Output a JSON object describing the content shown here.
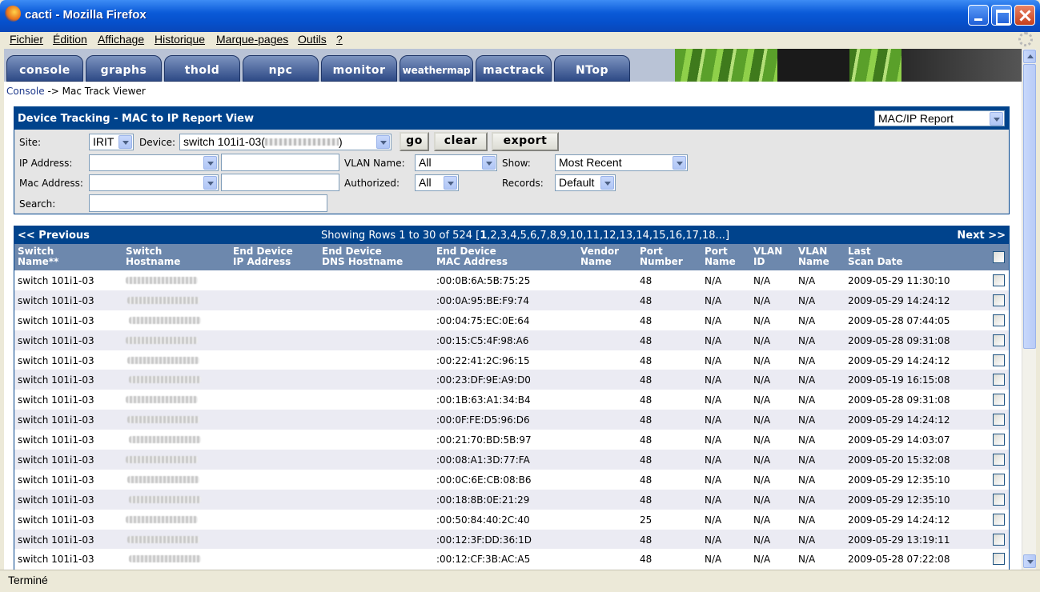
{
  "window": {
    "title": "cacti - Mozilla Firefox"
  },
  "menu": [
    "Fichier",
    "Édition",
    "Affichage",
    "Historique",
    "Marque-pages",
    "Outils",
    "?"
  ],
  "tabs": [
    "console",
    "graphs",
    "thold",
    "npc",
    "monitor",
    "weathermap",
    "mactrack",
    "NTop"
  ],
  "breadcrumb": {
    "link": "Console",
    "rest": " -> Mac Track Viewer"
  },
  "filter": {
    "title": "Device Tracking - MAC to IP Report View",
    "report_select": "MAC/IP Report",
    "site_label": "Site:",
    "site_value": "IRIT",
    "device_label": "Device:",
    "device_value": "switch 101i1-03(",
    "device_suffix": ")",
    "go": "go",
    "clear": "clear",
    "export": "export",
    "ip_label": "IP Address:",
    "vlan_label": "VLAN Name:",
    "vlan_value": "All",
    "show_label": "Show:",
    "show_value": "Most Recent",
    "mac_label": "Mac Address:",
    "authorized_label": "Authorized:",
    "authorized_value": "All",
    "records_label": "Records:",
    "records_value": "Default",
    "search_label": "Search:"
  },
  "results": {
    "prev": "<< Previous",
    "next": "Next >>",
    "showing_prefix": "Showing Rows 1 to 30 of 524 [",
    "showing_current": "1",
    "showing_pages": ",2,3,4,5,6,7,8,9,10,11,12,13,14,15,16,17,18...]",
    "headers": [
      [
        "Switch",
        "Name**"
      ],
      [
        "Switch",
        "Hostname"
      ],
      [
        "End Device",
        "IP Address"
      ],
      [
        "End Device",
        "DNS Hostname"
      ],
      [
        "End Device",
        "MAC Address"
      ],
      [
        "Vendor",
        "Name"
      ],
      [
        "Port",
        "Number"
      ],
      [
        "Port",
        "Name"
      ],
      [
        "VLAN",
        "ID"
      ],
      [
        "VLAN",
        "Name"
      ],
      [
        "Last",
        "Scan Date"
      ]
    ],
    "rows": [
      {
        "switch": "switch 101i1-03",
        "mac": ":00:0B:6A:5B:75:25",
        "port": "48",
        "port_name": "N/A",
        "vlan_id": "N/A",
        "vlan_name": "N/A",
        "date": "2009-05-29 11:30:10"
      },
      {
        "switch": "switch 101i1-03",
        "mac": ":00:0A:95:BE:F9:74",
        "port": "48",
        "port_name": "N/A",
        "vlan_id": "N/A",
        "vlan_name": "N/A",
        "date": "2009-05-29 14:24:12"
      },
      {
        "switch": "switch 101i1-03",
        "mac": ":00:04:75:EC:0E:64",
        "port": "48",
        "port_name": "N/A",
        "vlan_id": "N/A",
        "vlan_name": "N/A",
        "date": "2009-05-28 07:44:05"
      },
      {
        "switch": "switch 101i1-03",
        "mac": ":00:15:C5:4F:98:A6",
        "port": "48",
        "port_name": "N/A",
        "vlan_id": "N/A",
        "vlan_name": "N/A",
        "date": "2009-05-28 09:31:08"
      },
      {
        "switch": "switch 101i1-03",
        "mac": ":00:22:41:2C:96:15",
        "port": "48",
        "port_name": "N/A",
        "vlan_id": "N/A",
        "vlan_name": "N/A",
        "date": "2009-05-29 14:24:12"
      },
      {
        "switch": "switch 101i1-03",
        "mac": ":00:23:DF:9E:A9:D0",
        "port": "48",
        "port_name": "N/A",
        "vlan_id": "N/A",
        "vlan_name": "N/A",
        "date": "2009-05-19 16:15:08"
      },
      {
        "switch": "switch 101i1-03",
        "mac": ":00:1B:63:A1:34:B4",
        "port": "48",
        "port_name": "N/A",
        "vlan_id": "N/A",
        "vlan_name": "N/A",
        "date": "2009-05-28 09:31:08"
      },
      {
        "switch": "switch 101i1-03",
        "mac": ":00:0F:FE:D5:96:D6",
        "port": "48",
        "port_name": "N/A",
        "vlan_id": "N/A",
        "vlan_name": "N/A",
        "date": "2009-05-29 14:24:12"
      },
      {
        "switch": "switch 101i1-03",
        "mac": ":00:21:70:BD:5B:97",
        "port": "48",
        "port_name": "N/A",
        "vlan_id": "N/A",
        "vlan_name": "N/A",
        "date": "2009-05-29 14:03:07"
      },
      {
        "switch": "switch 101i1-03",
        "mac": ":00:08:A1:3D:77:FA",
        "port": "48",
        "port_name": "N/A",
        "vlan_id": "N/A",
        "vlan_name": "N/A",
        "date": "2009-05-20 15:32:08"
      },
      {
        "switch": "switch 101i1-03",
        "mac": ":00:0C:6E:CB:08:B6",
        "port": "48",
        "port_name": "N/A",
        "vlan_id": "N/A",
        "vlan_name": "N/A",
        "date": "2009-05-29 12:35:10"
      },
      {
        "switch": "switch 101i1-03",
        "mac": ":00:18:8B:0E:21:29",
        "port": "48",
        "port_name": "N/A",
        "vlan_id": "N/A",
        "vlan_name": "N/A",
        "date": "2009-05-29 12:35:10"
      },
      {
        "switch": "switch 101i1-03",
        "mac": ":00:50:84:40:2C:40",
        "port": "25",
        "port_name": "N/A",
        "vlan_id": "N/A",
        "vlan_name": "N/A",
        "date": "2009-05-29 14:24:12"
      },
      {
        "switch": "switch 101i1-03",
        "mac": ":00:12:3F:DD:36:1D",
        "port": "48",
        "port_name": "N/A",
        "vlan_id": "N/A",
        "vlan_name": "N/A",
        "date": "2009-05-29 13:19:11"
      },
      {
        "switch": "switch 101i1-03",
        "mac": ":00:12:CF:3B:AC:A5",
        "port": "48",
        "port_name": "N/A",
        "vlan_id": "N/A",
        "vlan_name": "N/A",
        "date": "2009-05-28 07:22:08"
      }
    ]
  },
  "status": "Terminé"
}
